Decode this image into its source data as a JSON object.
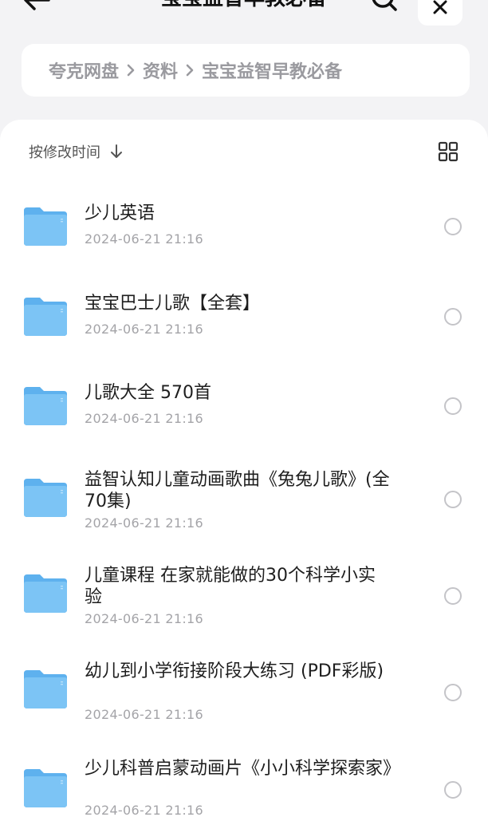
{
  "header": {
    "title": "宝宝益智早教必备",
    "back_icon": "arrow-left-icon",
    "search_icon": "search-icon",
    "close_icon": "close-icon"
  },
  "breadcrumb": {
    "items": [
      "夸克网盘",
      "资料",
      "宝宝益智早教必备"
    ]
  },
  "toolbar": {
    "sort_label": "按修改时间",
    "sort_icon": "arrow-down-icon",
    "view_icon": "grid-view-icon"
  },
  "files": [
    {
      "name": "少儿英语",
      "date": "2024-06-21 21:16"
    },
    {
      "name": "宝宝巴士儿歌【全套】",
      "date": "2024-06-21 21:16"
    },
    {
      "name": "儿歌大全 570首",
      "date": "2024-06-21 21:16"
    },
    {
      "name": "益智认知儿童动画歌曲《兔兔儿歌》(全70集)",
      "date": "2024-06-21 21:16"
    },
    {
      "name": "儿童课程 在家就能做的30个科学小实验",
      "date": "2024-06-21 21:16"
    },
    {
      "name": "幼儿到小学衔接阶段大练习 (PDF彩版)",
      "date": "2024-06-21 21:16"
    },
    {
      "name": "少儿科普启蒙动画片《小小科学探索家》",
      "date": "2024-06-21 21:16"
    }
  ],
  "colors": {
    "background": "#f3f3f5",
    "card": "#ffffff",
    "folder_front": "#7cc4f5",
    "folder_back": "#5eb1ee",
    "muted_text": "#9a9a9f"
  }
}
